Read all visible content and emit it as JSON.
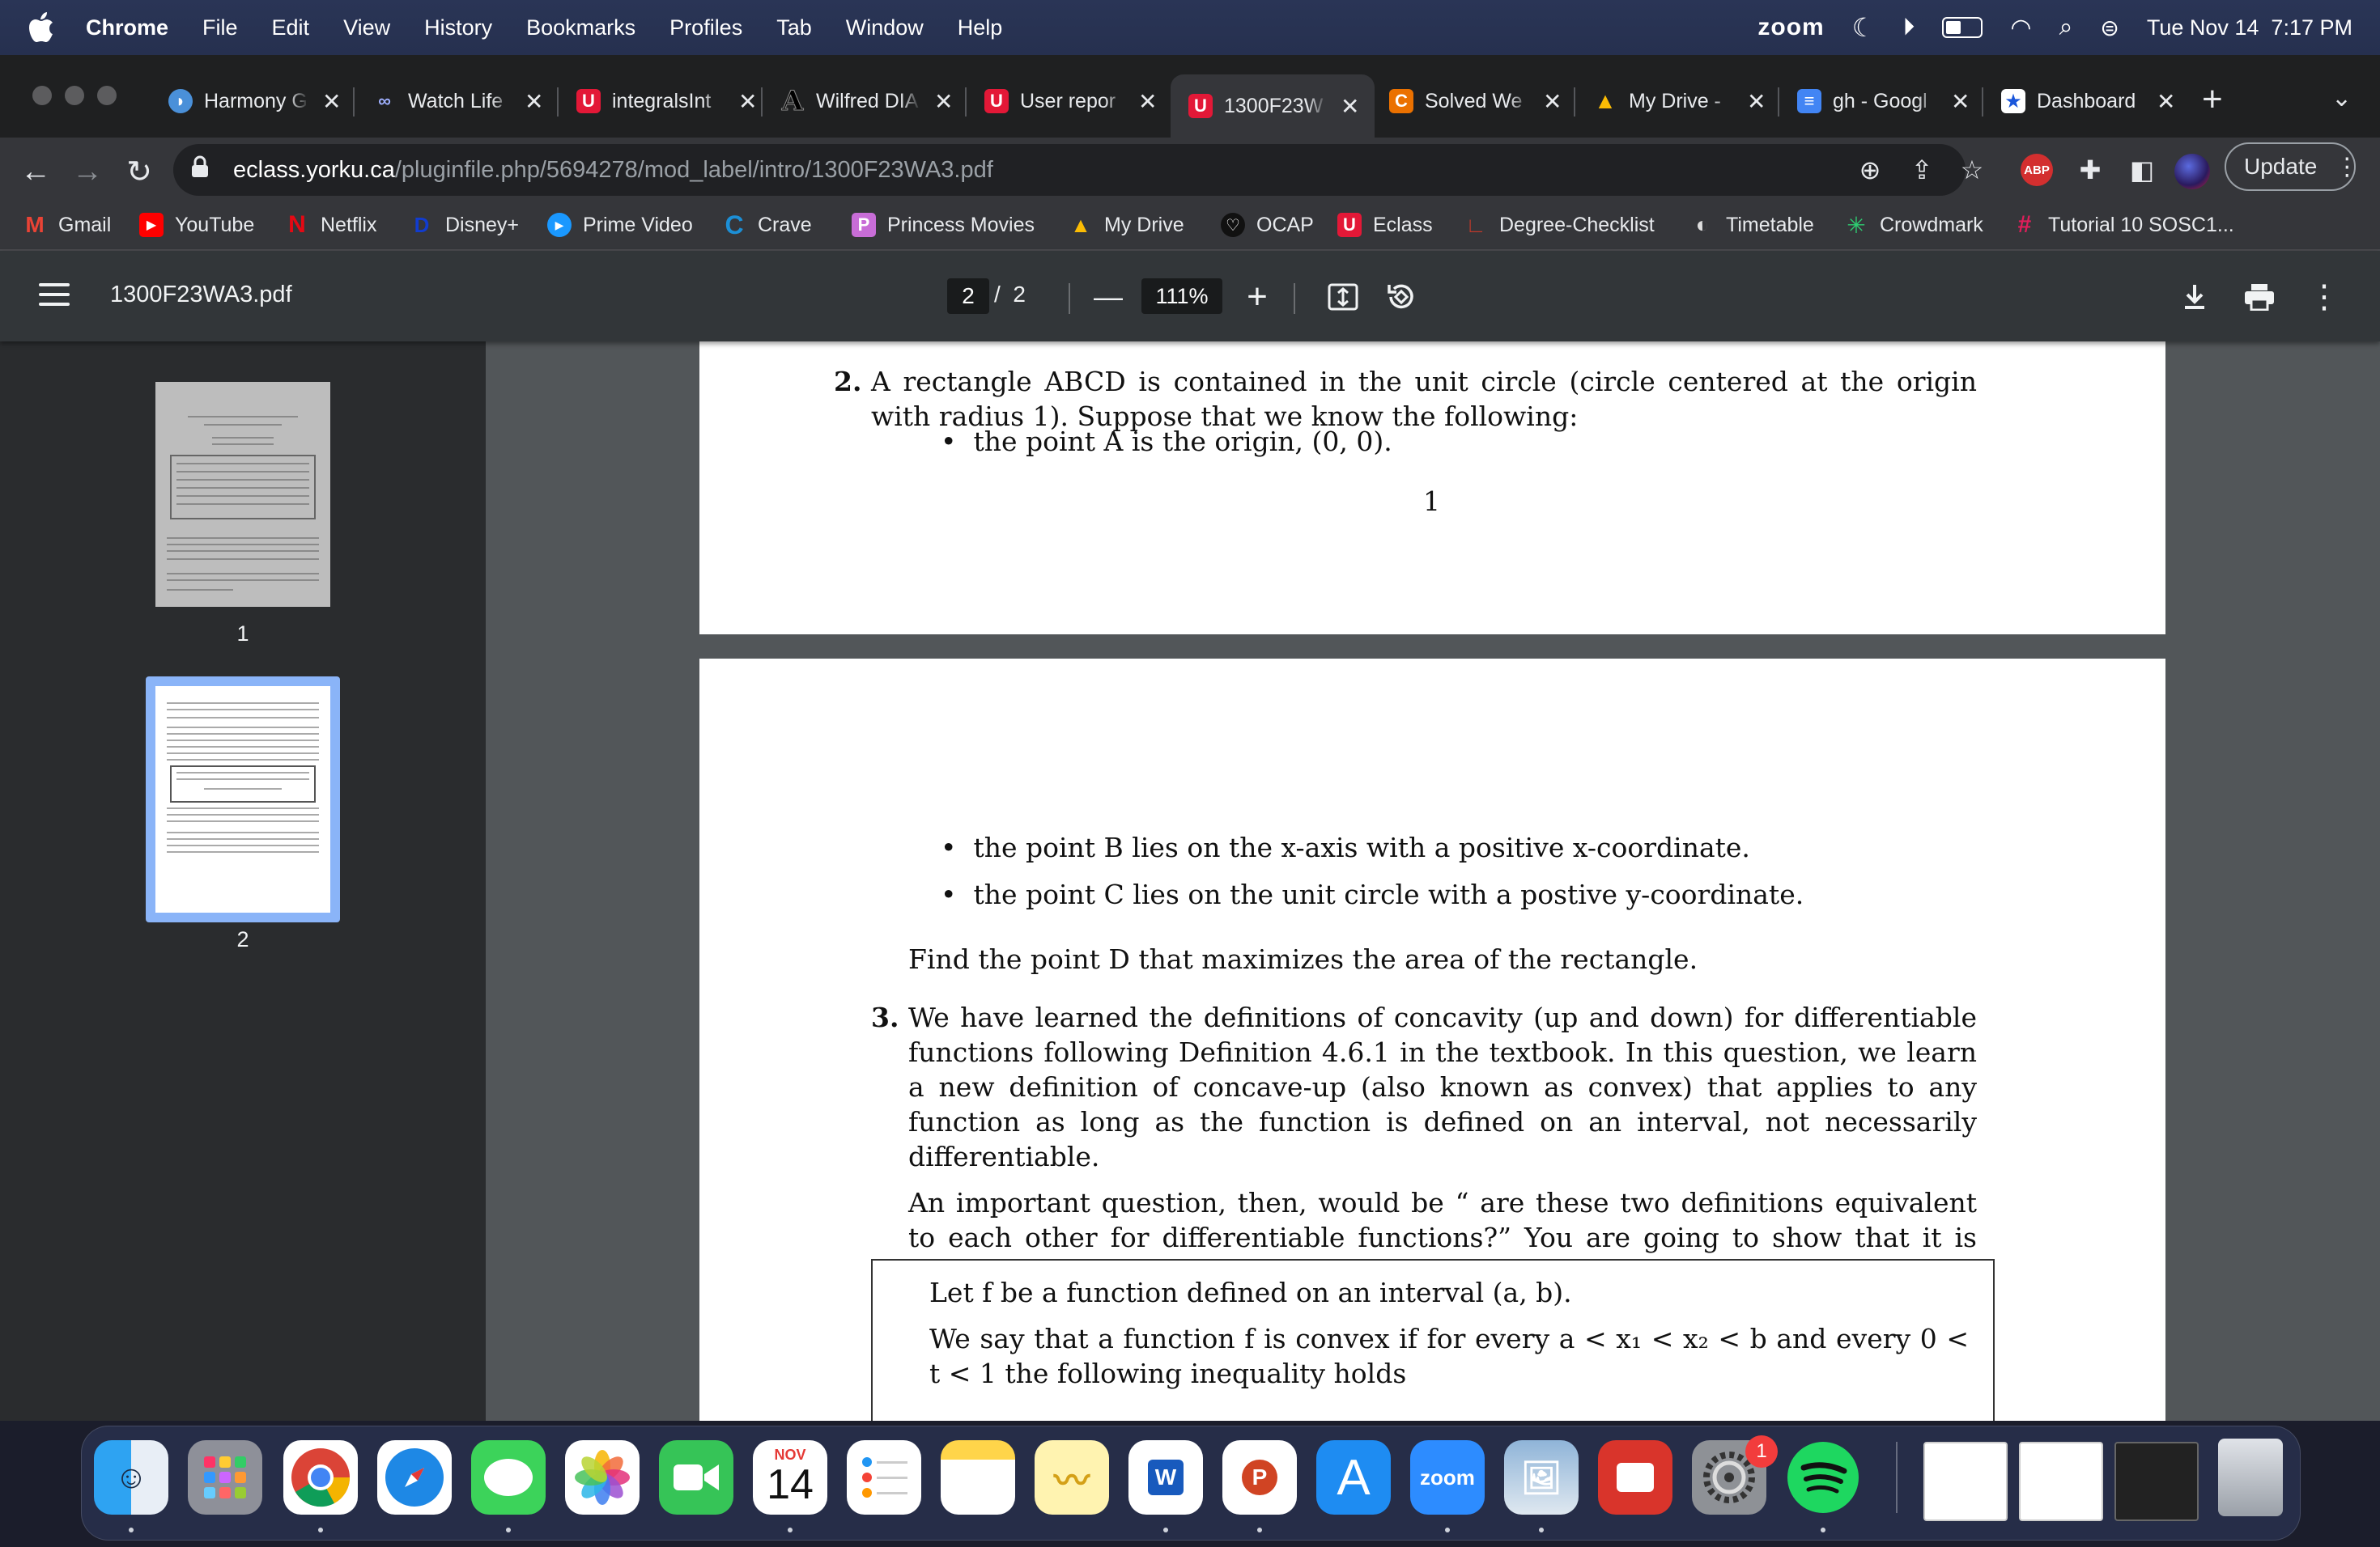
{
  "menubar": {
    "app": "Chrome",
    "items": [
      "File",
      "Edit",
      "View",
      "History",
      "Bookmarks",
      "Profiles",
      "Tab",
      "Window",
      "Help"
    ],
    "zoom": "zoom",
    "datetime": "Tue Nov 14  7:17 PM"
  },
  "tabs": [
    {
      "title": "Harmony G",
      "icon": "harmony-icon",
      "color": "#4a90d9"
    },
    {
      "title": "Watch Life",
      "icon": "watch-icon",
      "color": "#6b7bd6"
    },
    {
      "title": "integralsInt",
      "icon": "yorku-icon",
      "color": "#e31837"
    },
    {
      "title": "Wilfred DIA",
      "icon": "a-icon",
      "color": "#1f2021"
    },
    {
      "title": "User repor",
      "icon": "yorku-icon",
      "color": "#e31837"
    },
    {
      "title": "1300F23W",
      "icon": "yorku-icon",
      "color": "#e31837",
      "active": true
    },
    {
      "title": "Solved We",
      "icon": "chegg-icon",
      "color": "#eb7100"
    },
    {
      "title": "My Drive -",
      "icon": "drive-icon",
      "color": "#1fa463"
    },
    {
      "title": "gh - Googl",
      "icon": "docs-icon",
      "color": "#4285f4"
    },
    {
      "title": "Dashboard",
      "icon": "star-icon",
      "color": "#1a56db"
    }
  ],
  "address": {
    "host": "eclass.yorku.ca",
    "path": "/pluginfile.php/5694278/mod_label/intro/1300F23WA3.pdf"
  },
  "update_label": "Update",
  "bookmarks": [
    {
      "label": "Gmail",
      "color": "#ea4335",
      "glyph": "M"
    },
    {
      "label": "YouTube",
      "color": "#ff0000",
      "glyph": "▶"
    },
    {
      "label": "Netflix",
      "color": "#e50914",
      "glyph": "N"
    },
    {
      "label": "Disney+",
      "color": "#113ccf",
      "glyph": "D"
    },
    {
      "label": "Prime Video",
      "color": "#1a98ff",
      "glyph": "▶"
    },
    {
      "label": "Crave",
      "color": "#1c8fd6",
      "glyph": "C"
    },
    {
      "label": "Princess Movies",
      "color": "#c86dd7",
      "glyph": "P"
    },
    {
      "label": "My Drive",
      "color": "#1fa463",
      "glyph": "▲"
    },
    {
      "label": "OCAP",
      "color": "#3a3a3a",
      "glyph": "♡"
    },
    {
      "label": "Eclass",
      "color": "#e31837",
      "glyph": "U"
    },
    {
      "label": "Degree-Checklist",
      "color": "#c0392b",
      "glyph": "∟"
    },
    {
      "label": "Timetable",
      "color": "#777777",
      "glyph": "◐"
    },
    {
      "label": "Crowdmark",
      "color": "#2ecc71",
      "glyph": "✳"
    },
    {
      "label": "Tutorial 10 SOSC1...",
      "color": "#e01e5a",
      "glyph": "#"
    }
  ],
  "pdf": {
    "filename": "1300F23WA3.pdf",
    "page_current": "2",
    "page_total": "/  2",
    "zoom": "111%",
    "thumbs": [
      "1",
      "2"
    ]
  },
  "doc": {
    "q2_num": "2.",
    "q2_text": "A rectangle ABCD is contained in the unit circle (circle centered at the origin with radius 1). Suppose that we know the following:",
    "bullet_a": "the point A is the origin, (0, 0).",
    "page_number": "1",
    "bullet_b": "the point B lies on the x-axis with a positive x-coordinate.",
    "bullet_c": "the point C lies on the unit circle with a postive y-coordinate.",
    "find_d": "Find the point D that maximizes the area of the rectangle.",
    "q3_num": "3.",
    "q3_text": "We have learned the definitions of concavity (up and down) for differentiable functions following Definition 4.6.1 in the textbook. In this question, we learn a new definition of concave-up (also known as convex) that applies to any function as long as the function is defined on an interval, not necessarily differentiable.",
    "q3_para2": "An important question, then, would be “ are these two definitions equivalent to each other for differentiable functions?” You are going to show that it is partially true.",
    "box_line1": "Let f be a function defined on an interval (a, b).",
    "box_line2": "We say that a function f is convex if for every a < x₁ < x₂ < b and every 0 < t < 1 the following inequality holds"
  },
  "dock": {
    "calendar_month": "NOV",
    "calendar_day": "14",
    "zoom_label": "zoom",
    "settings_badge": "1",
    "apps": [
      "finder-icon",
      "launchpad-icon",
      "chrome-icon",
      "safari-icon",
      "messages-icon",
      "photos-icon",
      "facetime-icon",
      "calendar-icon",
      "reminders-icon",
      "notes-icon",
      "freeform-icon",
      "word-icon",
      "powerpoint-icon",
      "appstore-icon",
      "zoom-icon",
      "preview-icon",
      "photobooth-icon",
      "settings-icon",
      "spotify-icon"
    ]
  }
}
